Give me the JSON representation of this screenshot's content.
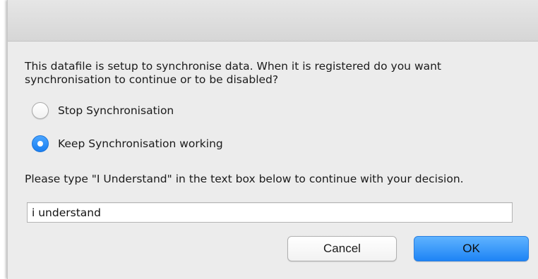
{
  "dialog": {
    "message": "This datafile is setup to synchronise data. When it is registered do you want synchronisation to continue or to be disabled?",
    "options": [
      {
        "label": "Stop Synchronisation",
        "selected": false
      },
      {
        "label": "Keep Synchronisation working",
        "selected": true
      }
    ],
    "instruction": "Please type \"I Understand\" in the text box below to continue with your decision.",
    "input_value": "i understand",
    "buttons": {
      "cancel_label": "Cancel",
      "ok_label": "OK"
    }
  },
  "colors": {
    "accent": "#1a7ff1",
    "dialog_background": "#ececec"
  },
  "icons": {
    "radio_unselected": "radio-unselected-icon",
    "radio_selected": "radio-selected-icon"
  }
}
